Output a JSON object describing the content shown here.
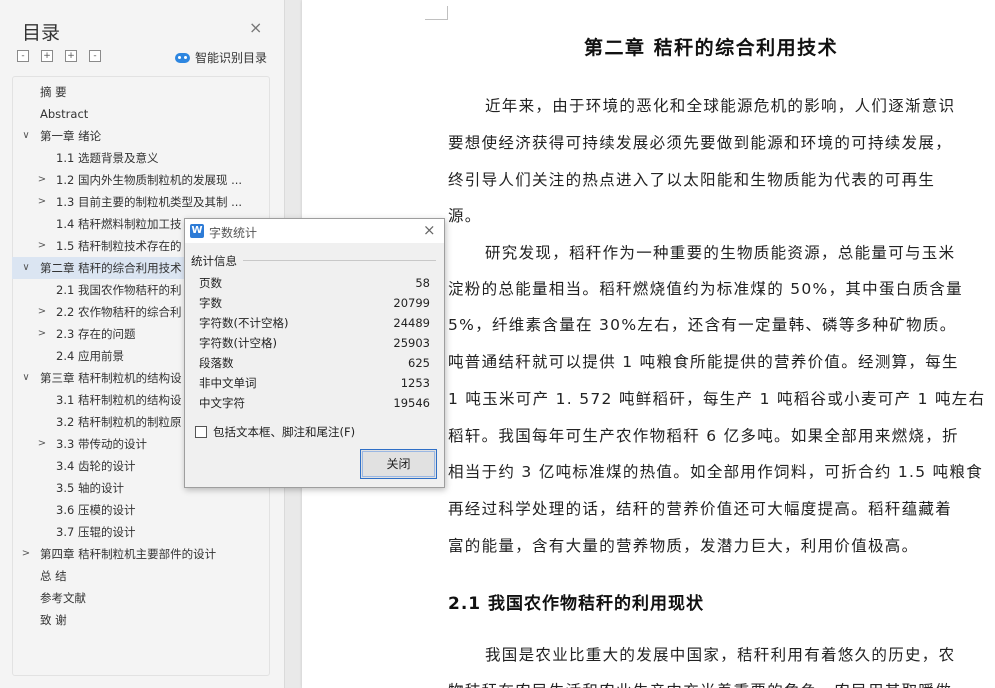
{
  "nav": {
    "title": "目录",
    "close_glyph": "×",
    "toolbar": {
      "collapse": "-",
      "expand": "+",
      "add": "+",
      "remove": "-"
    },
    "smart_toc_label": "智能识别目录",
    "items": [
      {
        "text": "摘    要",
        "level": 0,
        "twisty": ""
      },
      {
        "text": "Abstract",
        "level": 0,
        "twisty": ""
      },
      {
        "text": "第一章  绪论",
        "level": 0,
        "twisty": "∨"
      },
      {
        "text": "1.1 选题背景及意义",
        "level": 1,
        "twisty": ""
      },
      {
        "text": "1.2 国内外生物质制粒机的发展现 ...",
        "level": 1,
        "twisty": ">"
      },
      {
        "text": "1.3 目前主要的制粒机类型及其制 ...",
        "level": 1,
        "twisty": ">"
      },
      {
        "text": "1.4 秸秆燃料制粒加工技",
        "level": 1,
        "twisty": ""
      },
      {
        "text": "1.5 秸秆制粒技术存在的",
        "level": 1,
        "twisty": ">"
      },
      {
        "text": "第二章  秸秆的综合利用技术",
        "level": 0,
        "twisty": "∨",
        "selected": true
      },
      {
        "text": "2.1 我国农作物秸秆的利",
        "level": 1,
        "twisty": ""
      },
      {
        "text": "2.2 农作物秸秆的综合利",
        "level": 1,
        "twisty": ">"
      },
      {
        "text": "2.3 存在的问题",
        "level": 1,
        "twisty": ">"
      },
      {
        "text": "2.4 应用前景",
        "level": 1,
        "twisty": ""
      },
      {
        "text": "第三章  秸秆制粒机的结构设",
        "level": 0,
        "twisty": "∨"
      },
      {
        "text": "3.1 秸秆制粒机的结构设",
        "level": 1,
        "twisty": ""
      },
      {
        "text": "3.2 秸秆制粒机的制粒原",
        "level": 1,
        "twisty": ""
      },
      {
        "text": "3.3 带传动的设计",
        "level": 1,
        "twisty": ">"
      },
      {
        "text": "3.4 齿轮的设计",
        "level": 1,
        "twisty": ""
      },
      {
        "text": "3.5 轴的设计",
        "level": 1,
        "twisty": ""
      },
      {
        "text": "3.6 压模的设计",
        "level": 1,
        "twisty": ""
      },
      {
        "text": "3.7 压辊的设计",
        "level": 1,
        "twisty": ""
      },
      {
        "text": "第四章  秸秆制粒机主要部件的设计",
        "level": 0,
        "twisty": ">"
      },
      {
        "text": "总    结",
        "level": 0,
        "twisty": ""
      },
      {
        "text": "参考文献",
        "level": 0,
        "twisty": ""
      },
      {
        "text": "致    谢",
        "level": 0,
        "twisty": ""
      }
    ]
  },
  "document": {
    "chapter_title": "第二章   秸秆的综合利用技术",
    "lines": [
      "近年来，由于环境的恶化和全球能源危机的影响，人们逐渐意识",
      "要想使经济获得可持续发展必须先要做到能源和环境的可持续发展，",
      "终引导人们关注的热点进入了以太阳能和生物质能为代表的可再生",
      "源。",
      "研究发现，稻秆作为一种重要的生物质能资源，总能量可与玉米",
      "淀粉的总能量相当。稻秆燃烧值约为标准煤的 50%，其中蛋白质含量",
      "5%，纤维素含量在 30%左右，还含有一定量韩、磷等多种矿物质。",
      "吨普通结秆就可以提供 1 吨粮食所能提供的营养价值。经测算，每生",
      "1 吨玉米可产 1. 572 吨鲜稻矸，每生产 1 吨稻谷或小麦可产 1 吨左右",
      "稻轩。我国每年可生产农作物稻秆 6 亿多吨。如果全部用来燃烧，折",
      "相当于约 3 亿吨标准煤的热值。如全部用作饲料，可折合约 1.5 吨粮食",
      "再经过科学处理的话，结秆的营养价值还可大幅度提高。稻秆蕴藏着",
      "富的能量，含有大量的营养物质，发潜力巨大，利用价值极高。"
    ],
    "section_heading": "2.1 我国农作物秸秆的利用现状",
    "tail_lines": [
      "我国是农业比重大的发展中国家，秸秆利用有着悠久的历史，农",
      "物秸秆在农民生活和农业生产中充当着重要的角色，农民用其取暖做"
    ]
  },
  "dialog": {
    "logo_letter": "W",
    "title": "字数统计",
    "close_glyph": "×",
    "group_label": "统计信息",
    "stats": [
      {
        "label": "页数",
        "value": "58"
      },
      {
        "label": "字数",
        "value": "20799"
      },
      {
        "label": "字符数(不计空格)",
        "value": "24489"
      },
      {
        "label": "字符数(计空格)",
        "value": "25903"
      },
      {
        "label": "段落数",
        "value": "625"
      },
      {
        "label": "非中文单词",
        "value": "1253"
      },
      {
        "label": "中文字符",
        "value": "19546"
      }
    ],
    "checkbox_label": "包括文本框、脚注和尾注(F)",
    "checkbox_checked": false,
    "close_button": "关闭"
  },
  "colors": {
    "accent": "#2d7bd6",
    "selected_row": "#dbe5f2",
    "page": "#ffffff",
    "pane": "#f4f4f4"
  }
}
